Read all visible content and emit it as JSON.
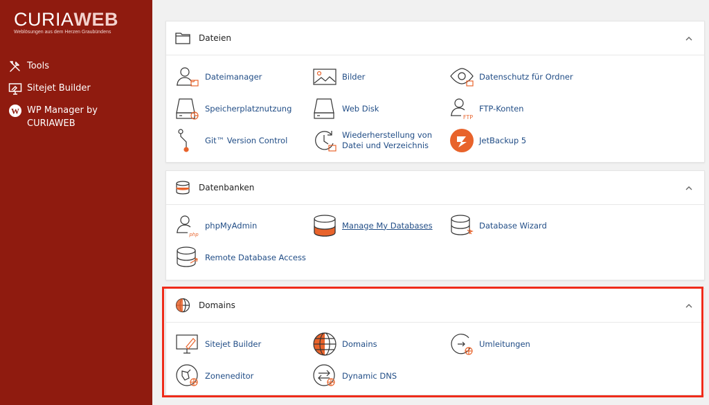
{
  "brand": {
    "logo_part1": "CURIA",
    "logo_part2": "WEB",
    "tagline": "Weblösungen aus dem Herzen Graubündens"
  },
  "sidebar": {
    "items": [
      {
        "label": "Tools",
        "icon": "tools-icon"
      },
      {
        "label": "Sitejet Builder",
        "icon": "monitor-icon"
      },
      {
        "label": "WP Manager by CURIAWEB",
        "icon": "wordpress-icon"
      }
    ]
  },
  "panels": {
    "files": {
      "title": "Dateien",
      "items": [
        {
          "label": "Dateimanager",
          "icon": "file-manager-icon"
        },
        {
          "label": "Bilder",
          "icon": "images-icon"
        },
        {
          "label": "Datenschutz für Ordner",
          "icon": "directory-privacy-icon"
        },
        {
          "label": "Speicherplatznutzung",
          "icon": "disk-usage-icon"
        },
        {
          "label": "Web Disk",
          "icon": "web-disk-icon"
        },
        {
          "label": "FTP-Konten",
          "icon": "ftp-accounts-icon"
        },
        {
          "label": "Git™ Version Control",
          "icon": "git-icon"
        },
        {
          "label": "Wiederherstellung von Datei und Verzeichnis",
          "icon": "file-restore-icon"
        },
        {
          "label": "JetBackup 5",
          "icon": "jetbackup-icon"
        }
      ]
    },
    "databases": {
      "title": "Datenbanken",
      "items": [
        {
          "label": "phpMyAdmin",
          "icon": "phpmyadmin-icon"
        },
        {
          "label": "Manage My Databases",
          "icon": "manage-databases-icon"
        },
        {
          "label": "Database Wizard",
          "icon": "database-wizard-icon"
        },
        {
          "label": "Remote Database Access",
          "icon": "remote-database-icon"
        }
      ]
    },
    "domains": {
      "title": "Domains",
      "items": [
        {
          "label": "Sitejet Builder",
          "icon": "sitejet-icon"
        },
        {
          "label": "Domains",
          "icon": "globe-icon"
        },
        {
          "label": "Umleitungen",
          "icon": "redirects-icon"
        },
        {
          "label": "Zoneneditor",
          "icon": "zone-editor-icon"
        },
        {
          "label": "Dynamic DNS",
          "icon": "dynamic-dns-icon"
        }
      ]
    }
  },
  "colors": {
    "sidebar": "#8f1b0f",
    "link": "#214d86",
    "accent": "#e8632b",
    "highlight": "#ef2b1a"
  }
}
